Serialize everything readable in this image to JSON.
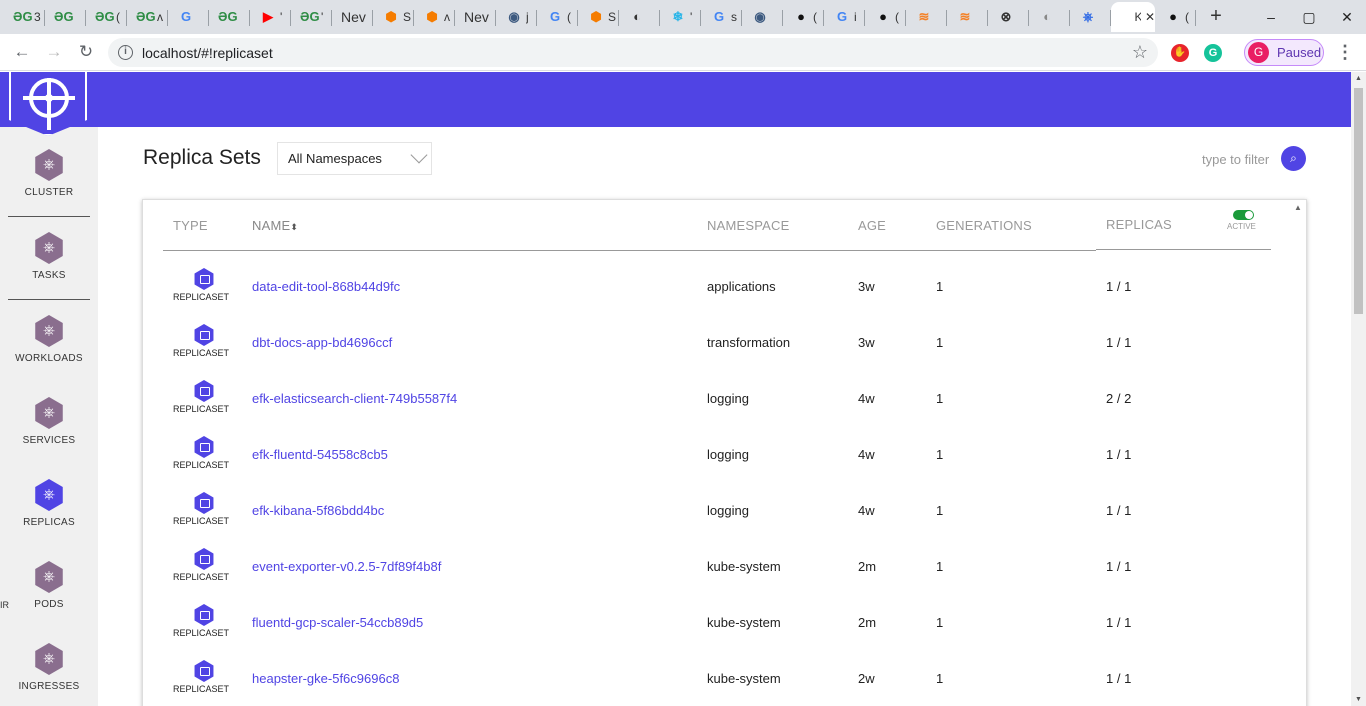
{
  "browser": {
    "tabs": [
      {
        "favicon": "ƏG",
        "color": "#2f8d46",
        "title": "3"
      },
      {
        "favicon": "ƏG",
        "color": "#2f8d46",
        "title": ""
      },
      {
        "favicon": "ƏG",
        "color": "#2f8d46",
        "title": "("
      },
      {
        "favicon": "ƏG",
        "color": "#2f8d46",
        "title": "ʌ"
      },
      {
        "favicon": "G",
        "color": "#4285f4",
        "title": ""
      },
      {
        "favicon": "ƏG",
        "color": "#2f8d46",
        "title": ""
      },
      {
        "favicon": "▶",
        "color": "#ff0000",
        "title": "'"
      },
      {
        "favicon": "ƏG",
        "color": "#2f8d46",
        "title": "'"
      },
      {
        "favicon": "Nev",
        "color": "#333333",
        "title": ""
      },
      {
        "favicon": "⬢",
        "color": "#f57c00",
        "title": "S"
      },
      {
        "favicon": "⬢",
        "color": "#f57c00",
        "title": "ʌ"
      },
      {
        "favicon": "Nev",
        "color": "#333333",
        "title": ""
      },
      {
        "favicon": "◉",
        "color": "#3d5a80",
        "title": "j"
      },
      {
        "favicon": "G",
        "color": "#4285f4",
        "title": "("
      },
      {
        "favicon": "⬢",
        "color": "#f57c00",
        "title": "S"
      },
      {
        "favicon": "◐",
        "color": "#333333",
        "title": ""
      },
      {
        "favicon": "❄",
        "color": "#29b5e8",
        "title": "'"
      },
      {
        "favicon": "G",
        "color": "#4285f4",
        "title": "s"
      },
      {
        "favicon": "◉",
        "color": "#3d5a80",
        "title": ""
      },
      {
        "favicon": "●",
        "color": "#111111",
        "title": "("
      },
      {
        "favicon": "G",
        "color": "#4285f4",
        "title": "i"
      },
      {
        "favicon": "●",
        "color": "#111111",
        "title": "("
      },
      {
        "favicon": "≋",
        "color": "#f48024",
        "title": ""
      },
      {
        "favicon": "≋",
        "color": "#f48024",
        "title": ""
      },
      {
        "favicon": "⊗",
        "color": "#333333",
        "title": ""
      },
      {
        "favicon": "◐",
        "color": "#888888",
        "title": ""
      },
      {
        "favicon": "⎈",
        "color": "#326ce5",
        "title": ""
      },
      {
        "favicon": "",
        "color": "#333333",
        "title": "K",
        "active": true,
        "close": "✕"
      },
      {
        "favicon": "●",
        "color": "#111111",
        "title": "("
      }
    ],
    "new_tab": "+",
    "window_controls": {
      "minimize": "–",
      "maximize": "▢",
      "close": "✕"
    },
    "url": "localhost/#!replicaset",
    "profile": {
      "initial": "G",
      "label": "Paused"
    }
  },
  "sidebar": {
    "items": [
      {
        "label": "CLUSTER",
        "icon": "cluster-icon",
        "selected": false
      },
      {
        "label": "TASKS",
        "icon": "tasks-icon",
        "selected": false
      },
      {
        "label": "WORKLOADS",
        "icon": "deploy-icon",
        "selected": false
      },
      {
        "label": "SERVICES",
        "icon": "svc-icon",
        "selected": false
      },
      {
        "label": "REPLICAS",
        "icon": "rs-icon",
        "selected": true
      },
      {
        "label": "PODS",
        "icon": "pod-icon",
        "selected": false
      },
      {
        "label": "INGRESSES",
        "icon": "ing-icon",
        "selected": false
      }
    ],
    "stray_text": "IR"
  },
  "main": {
    "title": "Replica Sets",
    "namespace_select": "All Namespaces",
    "filter_placeholder": "type to filter"
  },
  "table": {
    "headers": {
      "type": "TYPE",
      "name": "NAME",
      "sort_indicator": "⬍",
      "namespace": "NAMESPACE",
      "age": "AGE",
      "generations": "GENERATIONS",
      "replicas": "REPLICAS",
      "active": "ACTIVE"
    },
    "rows": [
      {
        "type": "REPLICASET",
        "name": "data-edit-tool-868b44d9fc",
        "namespace": "applications",
        "age": "3w",
        "generations": "1",
        "replicas": "1 / 1"
      },
      {
        "type": "REPLICASET",
        "name": "dbt-docs-app-bd4696ccf",
        "namespace": "transformation",
        "age": "3w",
        "generations": "1",
        "replicas": "1 / 1"
      },
      {
        "type": "REPLICASET",
        "name": "efk-elasticsearch-client-749b5587f4",
        "namespace": "logging",
        "age": "4w",
        "generations": "1",
        "replicas": "2 / 2"
      },
      {
        "type": "REPLICASET",
        "name": "efk-fluentd-54558c8cb5",
        "namespace": "logging",
        "age": "4w",
        "generations": "1",
        "replicas": "1 / 1"
      },
      {
        "type": "REPLICASET",
        "name": "efk-kibana-5f86bdd4bc",
        "namespace": "logging",
        "age": "4w",
        "generations": "1",
        "replicas": "1 / 1"
      },
      {
        "type": "REPLICASET",
        "name": "event-exporter-v0.2.5-7df89f4b8f",
        "namespace": "kube-system",
        "age": "2m",
        "generations": "1",
        "replicas": "1 / 1"
      },
      {
        "type": "REPLICASET",
        "name": "fluentd-gcp-scaler-54ccb89d5",
        "namespace": "kube-system",
        "age": "2m",
        "generations": "1",
        "replicas": "1 / 1"
      },
      {
        "type": "REPLICASET",
        "name": "heapster-gke-5f6c9696c8",
        "namespace": "kube-system",
        "age": "2w",
        "generations": "1",
        "replicas": "1 / 1"
      }
    ]
  },
  "colors": {
    "accent": "#5044e4",
    "nav_icon": "#8a6e8e",
    "toggle_on": "#1a9a3a"
  }
}
